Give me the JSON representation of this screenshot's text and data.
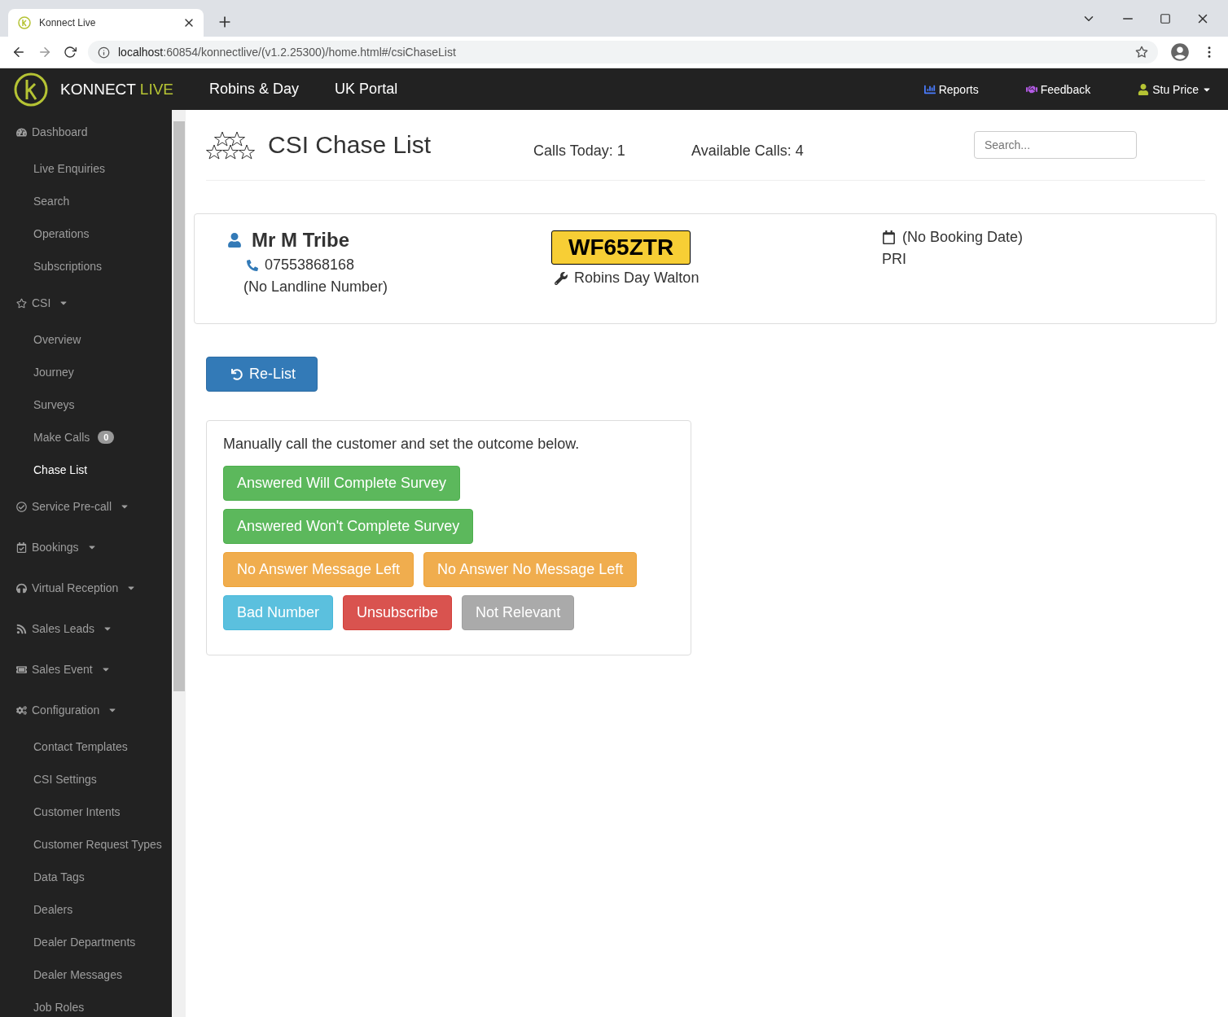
{
  "browser": {
    "tab_title": "Konnect Live",
    "url_host": "localhost",
    "url_rest": ":60854/konnectlive/(v1.2.25300)/home.html#/csiChaseList"
  },
  "navbar": {
    "brand": "KONNECT",
    "brand_accent": "LIVE",
    "links": [
      "Robins & Day",
      "UK Portal"
    ],
    "right": [
      {
        "kind": "reports",
        "label": "Reports"
      },
      {
        "kind": "feedback",
        "label": "Feedback"
      },
      {
        "kind": "user",
        "label": "Stu Price"
      }
    ]
  },
  "sidebar": {
    "items": [
      {
        "kind": "group",
        "label": "Dashboard",
        "selected": false
      },
      {
        "kind": "link",
        "label": "Live Enquiries",
        "selected": false
      },
      {
        "kind": "link",
        "label": "Search",
        "selected": false
      },
      {
        "kind": "link",
        "label": "Operations",
        "selected": false
      },
      {
        "kind": "link",
        "label": "Subscriptions",
        "selected": false
      },
      {
        "kind": "group",
        "label": "CSI",
        "selected": false
      },
      {
        "kind": "link",
        "label": "Overview",
        "selected": false
      },
      {
        "kind": "link",
        "label": "Journey",
        "selected": false
      },
      {
        "kind": "link",
        "label": "Surveys",
        "selected": false
      },
      {
        "kind": "link",
        "label": "Make Calls",
        "badge": "0",
        "selected": false
      },
      {
        "kind": "link",
        "label": "Chase List",
        "selected": true
      },
      {
        "kind": "group",
        "label": "Service Pre-call",
        "selected": false
      },
      {
        "kind": "group",
        "label": "Bookings",
        "selected": false
      },
      {
        "kind": "group",
        "label": "Virtual Reception",
        "selected": false
      },
      {
        "kind": "group",
        "label": "Sales Leads",
        "selected": false
      },
      {
        "kind": "group",
        "label": "Sales Event",
        "selected": false
      },
      {
        "kind": "group",
        "label": "Configuration",
        "selected": false
      },
      {
        "kind": "link",
        "label": "Contact Templates",
        "selected": false
      },
      {
        "kind": "link",
        "label": "CSI Settings",
        "selected": false
      },
      {
        "kind": "link",
        "label": "Customer Intents",
        "selected": false
      },
      {
        "kind": "link",
        "label": "Customer Request Types",
        "selected": false
      },
      {
        "kind": "link",
        "label": "Data Tags",
        "selected": false
      },
      {
        "kind": "link",
        "label": "Dealers",
        "selected": false
      },
      {
        "kind": "link",
        "label": "Dealer Departments",
        "selected": false
      },
      {
        "kind": "link",
        "label": "Dealer Messages",
        "selected": false
      },
      {
        "kind": "link",
        "label": "Job Roles",
        "selected": false
      }
    ]
  },
  "header": {
    "title": "CSI Chase List",
    "calls_today": "Calls Today: 1",
    "available_calls": "Available Calls: 4",
    "search": {
      "placeholder": "Search..."
    }
  },
  "customer": {
    "name": "Mr M Tribe",
    "mobile": "07553868168",
    "landline": "(No Landline Number)",
    "registration": "WF65ZTR",
    "dealer": "Robins Day Walton",
    "booking_date": "(No Booking Date)",
    "code": "PRI"
  },
  "relist_button": "Re-List",
  "outcome": {
    "instruction": "Manually call the customer and set the outcome below.",
    "buttons": [
      {
        "kind": "success",
        "label": "Answered Will Complete Survey"
      },
      {
        "kind": "success",
        "label": "Answered Won't Complete Survey"
      },
      {
        "kind": "warning",
        "label": "No Answer Message Left"
      },
      {
        "kind": "warning",
        "label": "No Answer No Message Left"
      },
      {
        "kind": "info",
        "label": "Bad Number"
      },
      {
        "kind": "danger",
        "label": "Unsubscribe"
      },
      {
        "kind": "default",
        "label": "Not Relevant"
      }
    ]
  }
}
